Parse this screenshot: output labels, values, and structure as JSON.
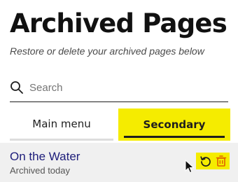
{
  "header": {
    "title": "Archived Pages",
    "subtitle": "Restore or delete your archived pages below"
  },
  "search": {
    "icon": "search-icon",
    "placeholder": "Search",
    "value": ""
  },
  "tabs": [
    {
      "label": "Main menu",
      "selected": false
    },
    {
      "label": "Secondary",
      "selected": true
    }
  ],
  "archived_pages": [
    {
      "title": "On the Water",
      "meta": "Archived today",
      "actions": [
        "restore-icon",
        "trash-icon"
      ]
    }
  ],
  "colors": {
    "highlight": "#f5ec00",
    "link": "#1d1d7a",
    "delete_icon": "#e06000",
    "row_background": "#f0f0f0"
  }
}
